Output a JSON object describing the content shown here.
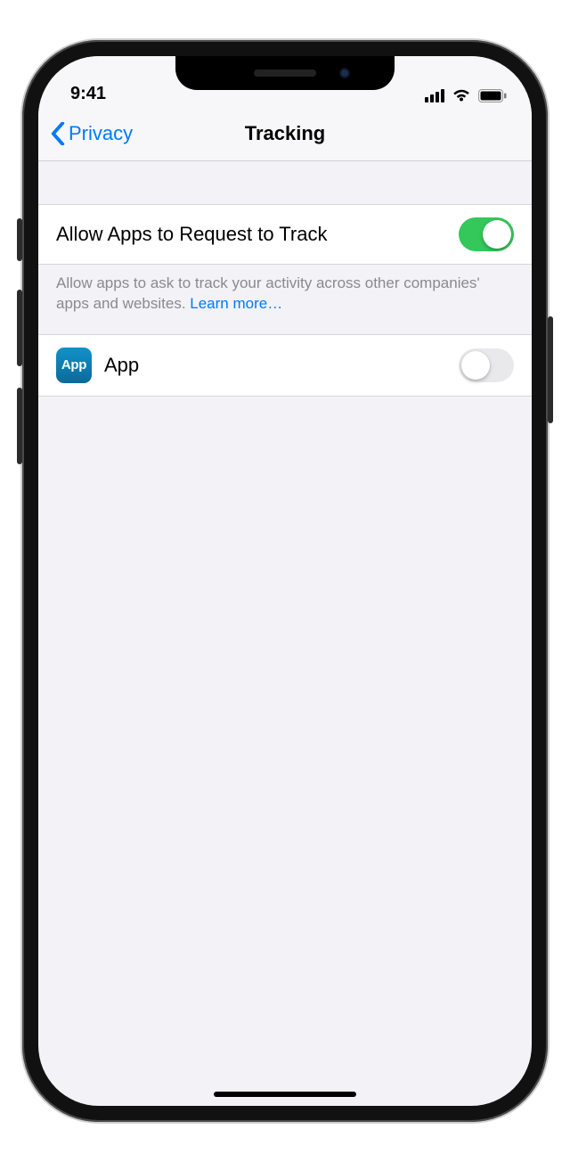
{
  "status": {
    "time": "9:41"
  },
  "nav": {
    "back_label": "Privacy",
    "title": "Tracking"
  },
  "settings": {
    "allow_request": {
      "label": "Allow Apps to Request to Track",
      "on": true
    },
    "footer_text": "Allow apps to ask to track your activity across other companies' apps and websites. ",
    "learn_more": "Learn more…"
  },
  "apps": [
    {
      "icon_label": "App",
      "name": "App",
      "on": false
    }
  ],
  "colors": {
    "ios_blue": "#007aff",
    "ios_green": "#34c759",
    "bg": "#f2f2f7"
  }
}
